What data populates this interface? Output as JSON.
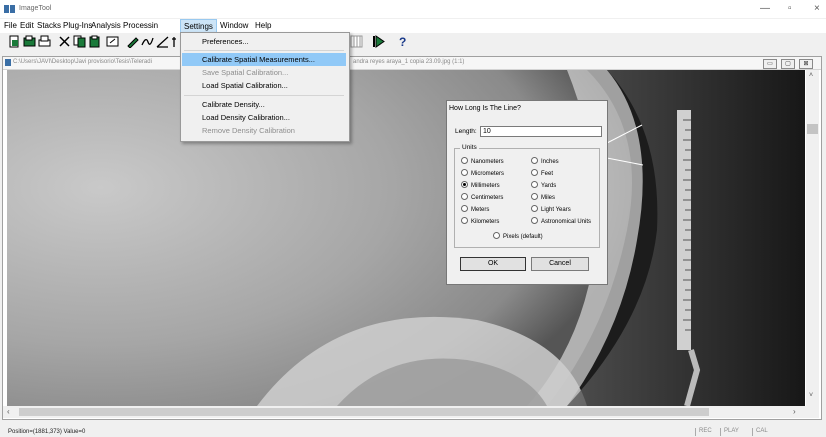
{
  "window": {
    "title": "ImageTool",
    "minimize": "—",
    "maximize": "▫",
    "close": "×"
  },
  "menubar": {
    "items": [
      "File",
      "Edit",
      "Stacks",
      "Plug-Ins",
      "Analysis",
      "Processin",
      "Settings",
      "Window",
      "Help"
    ]
  },
  "document": {
    "path_left": "C:\\Users\\JAVI\\Desktop\\Javi provisorio\\Tesis\\Teleradi",
    "path_right": "andra reyes araya_1 copia 23.09.jpg (1:1)"
  },
  "settings_menu": {
    "items": [
      {
        "label": "Preferences...",
        "state": "normal"
      },
      {
        "label": "Calibrate Spatial Measurements...",
        "state": "highlighted"
      },
      {
        "label": "Save Spatial Calibration...",
        "state": "disabled"
      },
      {
        "label": "Load Spatial Calibration...",
        "state": "normal"
      },
      {
        "label": "Calibrate Density...",
        "state": "normal"
      },
      {
        "label": "Load Density Calibration...",
        "state": "normal"
      },
      {
        "label": "Remove Density Calibration",
        "state": "disabled"
      }
    ]
  },
  "dialog": {
    "title": "How Long Is The Line?",
    "length_label": "Length:",
    "length_value": "10",
    "units_label": "Units",
    "units": [
      {
        "label": "Nanometers",
        "checked": false
      },
      {
        "label": "Inches",
        "checked": false
      },
      {
        "label": "Micrometers",
        "checked": false
      },
      {
        "label": "Feet",
        "checked": false
      },
      {
        "label": "Millimeters",
        "checked": true
      },
      {
        "label": "Yards",
        "checked": false
      },
      {
        "label": "Centimeters",
        "checked": false
      },
      {
        "label": "Miles",
        "checked": false
      },
      {
        "label": "Meters",
        "checked": false
      },
      {
        "label": "Light Years",
        "checked": false
      },
      {
        "label": "Kilometers",
        "checked": false
      },
      {
        "label": "Astronomical Units",
        "checked": false
      }
    ],
    "pixels_label": "Pixels (default)",
    "ok_label": "OK",
    "cancel_label": "Cancel"
  },
  "statusbar": {
    "position": "Position=(1881,373)  Value=0",
    "rec": "REC",
    "play": "PLAY",
    "cal": "CAL"
  },
  "colors": {
    "menu_highlight": "#91c9f7",
    "accent_toolbar": "#1a7a3a"
  }
}
